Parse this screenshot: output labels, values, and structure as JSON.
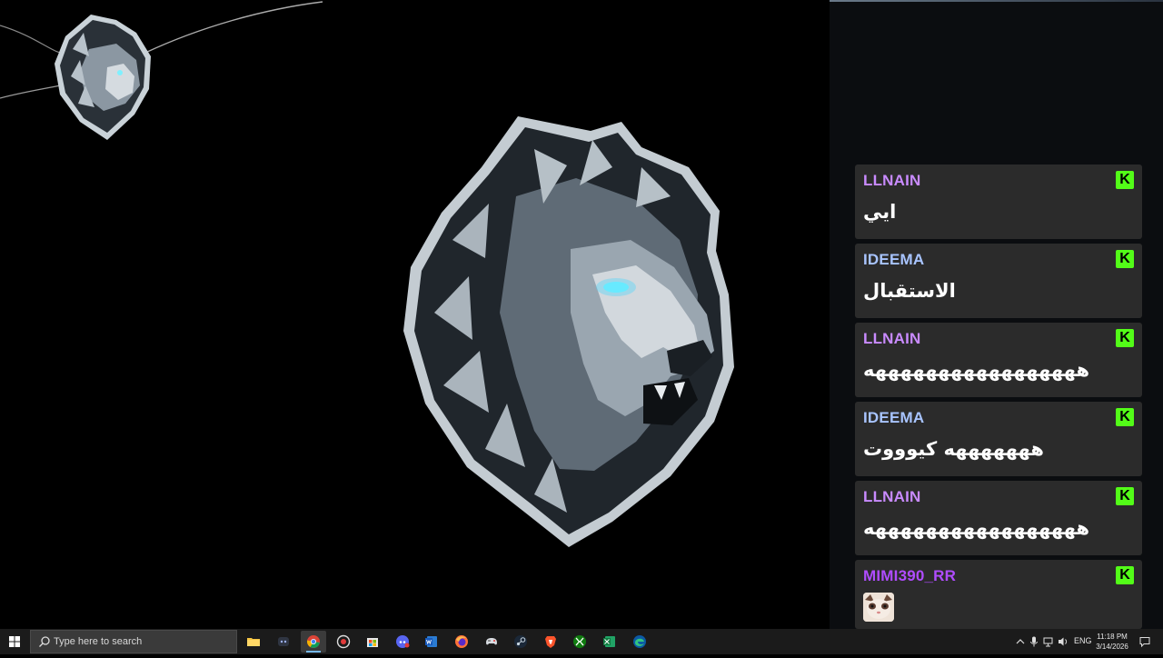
{
  "chat": {
    "platform_badge": "K",
    "messages": [
      {
        "username": "LLNAIN",
        "text": "ايي",
        "user_color": "#c98bff"
      },
      {
        "username": "IDEEMA",
        "text": "الاستقبال",
        "user_color": "#a8c4ff"
      },
      {
        "username": "LLNAIN",
        "text": "هههههههههههههههههه",
        "user_color": "#c98bff"
      },
      {
        "username": "IDEEMA",
        "text": "هههههههه كيوووت",
        "user_color": "#a8c4ff"
      },
      {
        "username": "LLNAIN",
        "text": "هههههههههههههههههه",
        "user_color": "#c98bff"
      },
      {
        "username": "MIMI390_RR",
        "text": "",
        "user_color": "#b04cff",
        "emote": "cat-emote"
      }
    ],
    "badge_color": "#53fc18"
  },
  "taskbar": {
    "search_placeholder": "Type here to search",
    "apps": [
      "file-explorer",
      "discord-overlay",
      "chrome",
      "recorder",
      "microsoft-store",
      "discord",
      "word",
      "firefox",
      "app-gamepad",
      "steam",
      "brave",
      "xbox",
      "excel",
      "edge"
    ],
    "tray": {
      "language": "ENG",
      "time": "11:18 PM",
      "date": "3/14/2026"
    }
  },
  "colors": {
    "accent": "#76b9ed",
    "chat_bg": "#2b2b2b"
  }
}
